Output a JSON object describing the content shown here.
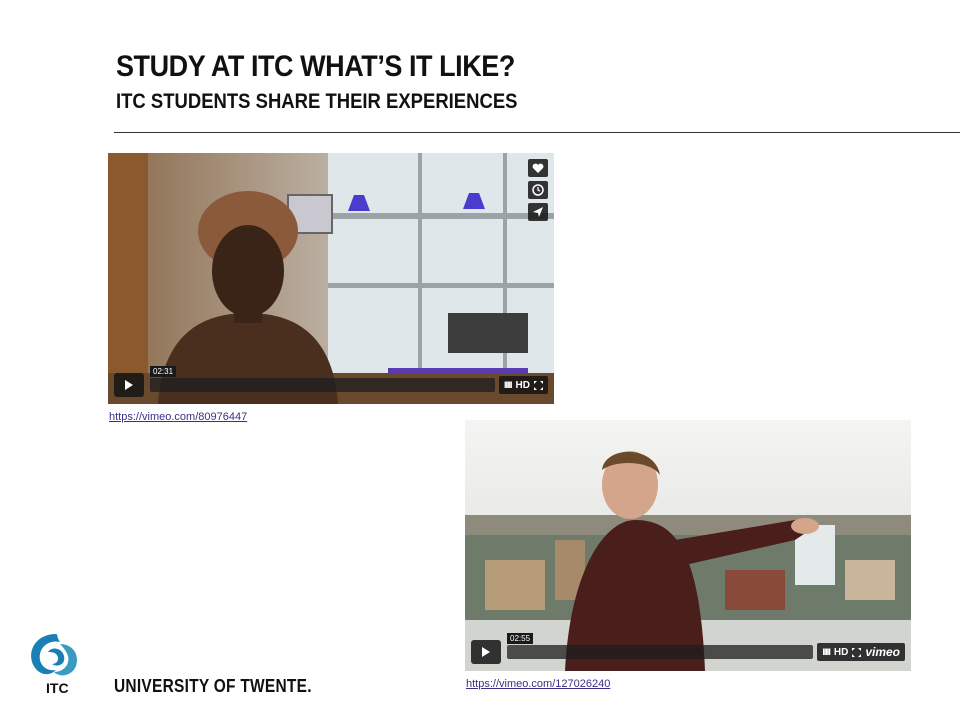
{
  "slide": {
    "title": "STUDY AT ITC WHAT’S IT LIKE?",
    "subtitle": "ITC STUDENTS SHARE THEIR EXPERIENCES"
  },
  "videos": [
    {
      "duration": "02:31",
      "hd_label": "HD",
      "url": "https://vimeo.com/80976447",
      "progress": 0.0
    },
    {
      "duration": "02:55",
      "hd_label": "HD",
      "brand": "vimeo",
      "url": "https://vimeo.com/127026240",
      "progress": 0.0
    }
  ],
  "footer": {
    "logo_text": "ITC",
    "university": "UNIVERSITY OF TWENTE."
  },
  "colors": {
    "link": "#3b2f8a",
    "logo_blue": "#1a7fb5",
    "logo_teal": "#3a9bc0"
  },
  "icons": [
    "heart-icon",
    "clock-icon",
    "send-icon",
    "play-icon",
    "fullscreen-icon"
  ]
}
